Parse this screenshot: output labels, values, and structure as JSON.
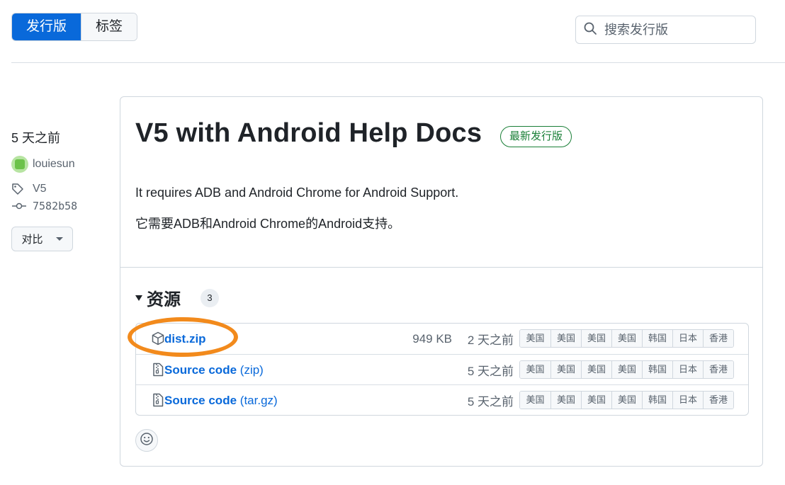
{
  "tabs": [
    {
      "label": "发行版",
      "active": true
    },
    {
      "label": "标签",
      "active": false
    }
  ],
  "search": {
    "placeholder": "搜索发行版",
    "icon": "search-icon"
  },
  "meta": {
    "date": "5 天之前",
    "author": "louiesun",
    "tag": "V5",
    "commit": "7582b58",
    "compare_label": "对比"
  },
  "release": {
    "title": "V5 with Android Help Docs",
    "badge": "最新发行版",
    "description_en": "It requires ADB and Android Chrome for Android Support.",
    "description_zh": "它需要ADB和Android Chrome的Android支持。"
  },
  "assets": {
    "title": "资源",
    "count": "3",
    "items": [
      {
        "name": "dist.zip",
        "suffix": "",
        "size": "949 KB",
        "date": "2 天之前",
        "icon": "package-icon"
      },
      {
        "name": "Source code",
        "suffix": "(zip)",
        "size": "",
        "date": "5 天之前",
        "icon": "file-zip-icon"
      },
      {
        "name": "Source code",
        "suffix": "(tar.gz)",
        "size": "",
        "date": "5 天之前",
        "icon": "file-zip-icon"
      }
    ],
    "mirrors": [
      "美国",
      "美国",
      "美国",
      "美国",
      "韩国",
      "日本",
      "香港"
    ]
  },
  "colors": {
    "accent": "#0969da",
    "success": "#1a7f37",
    "highlight": "#f28a1c"
  }
}
